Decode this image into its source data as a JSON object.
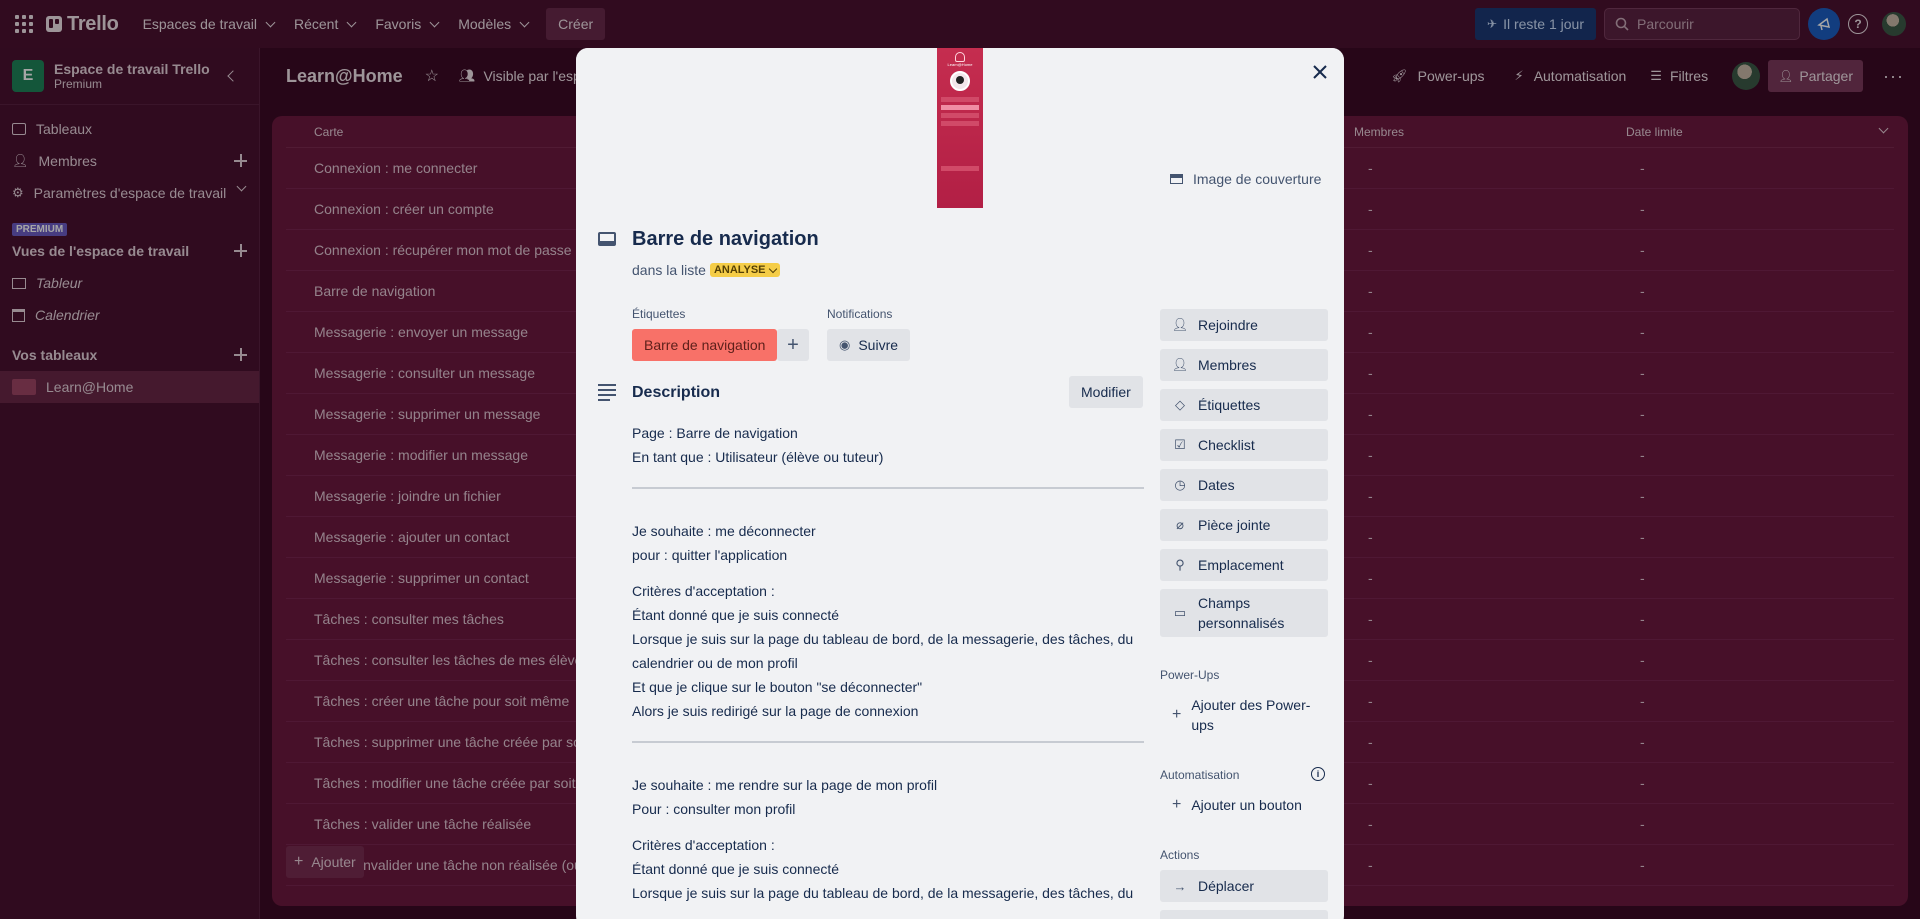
{
  "topbar": {
    "app_name": "Trello",
    "menus": [
      "Espaces de travail",
      "Récent",
      "Favoris",
      "Modèles"
    ],
    "create_label": "Créer",
    "trial_label": "Il reste 1 jour",
    "search_placeholder": "Parcourir"
  },
  "sidebar": {
    "workspace_initial": "E",
    "workspace_name": "Espace de travail Trello",
    "workspace_plan": "Premium",
    "items": [
      "Tableaux",
      "Membres",
      "Paramètres d'espace de travail"
    ],
    "premium_badge": "PREMIUM",
    "views_title": "Vues de l'espace de travail",
    "views": [
      "Tableur",
      "Calendrier"
    ],
    "boards_title": "Vos tableaux",
    "boards": [
      "Learn@Home"
    ]
  },
  "board": {
    "title": "Learn@Home",
    "visibility": "Visible par l'esp",
    "actions": [
      "Power-ups",
      "Automatisation",
      "Filtres"
    ],
    "share_label": "Partager",
    "columns": {
      "card": "Carte",
      "members": "Membres",
      "due": "Date limite"
    },
    "rows": [
      "Connexion : me connecter",
      "Connexion : créer un compte",
      "Connexion : récupérer mon mot de passe o",
      "Barre de navigation",
      "Messagerie : envoyer un message",
      "Messagerie : consulter un message",
      "Messagerie : supprimer un message",
      "Messagerie : modifier un message",
      "Messagerie : joindre un fichier",
      "Messagerie : ajouter un contact",
      "Messagerie : supprimer un contact",
      "Tâches : consulter mes tâches",
      "Tâches : consulter les tâches de mes élèves",
      "Tâches : créer une tâche pour soit même",
      "Tâches : supprimer une tâche créée par soit",
      "Tâches : modifier une tâche créée par soit m",
      "Tâches : valider une tâche réalisée",
      "invalider une tâche non réalisée (ou"
    ],
    "empty_cell": "-",
    "add_label": "Ajouter"
  },
  "card": {
    "cover_app_title": "Learn@Home",
    "cover_label": "Image de couverture",
    "title": "Barre de navigation",
    "list_prefix": "dans la liste",
    "list_name": "ANALYSE",
    "labels_heading": "Étiquettes",
    "label_chip": "Barre de navigation",
    "label_color": "#f87168",
    "notifications_heading": "Notifications",
    "watch_label": "Suivre",
    "description_heading": "Description",
    "edit_label": "Modifier",
    "description": {
      "block1": [
        "Page : Barre de navigation",
        "En tant que : Utilisateur (élève ou tuteur)"
      ],
      "block2": [
        "Je souhaite : me déconnecter",
        "pour : quitter l'application"
      ],
      "block3": [
        "Critères d'acceptation :",
        "Étant donné que je suis connecté",
        "Lorsque je suis sur la page du tableau de bord, de la messagerie, des tâches, du calendrier ou de mon profil",
        "Et que je clique sur le bouton \"se déconnecter\"",
        "Alors je suis redirigé sur la page de connexion"
      ],
      "block4": [
        "Je souhaite : me rendre sur la page de mon profil",
        "Pour : consulter mon profil"
      ],
      "block5": [
        "Critères d'acceptation :",
        "Étant donné que je suis connecté",
        "Lorsque je suis sur la page du tableau de bord, de la messagerie, des tâches, du"
      ]
    },
    "side_actions": [
      "Rejoindre",
      "Membres",
      "Étiquettes",
      "Checklist",
      "Dates",
      "Pièce jointe",
      "Emplacement",
      "Champs personnalisés"
    ],
    "powerups_heading": "Power-Ups",
    "add_powerups": "Ajouter des Power-ups",
    "automation_heading": "Automatisation",
    "add_button": "Ajouter un bouton",
    "actions_heading": "Actions",
    "move_label": "Déplacer"
  },
  "colors": {
    "accent": "#0c66e4",
    "board_bg": "#6d1a3f",
    "label": "#f87168",
    "list_badge": "#f5cd47"
  }
}
